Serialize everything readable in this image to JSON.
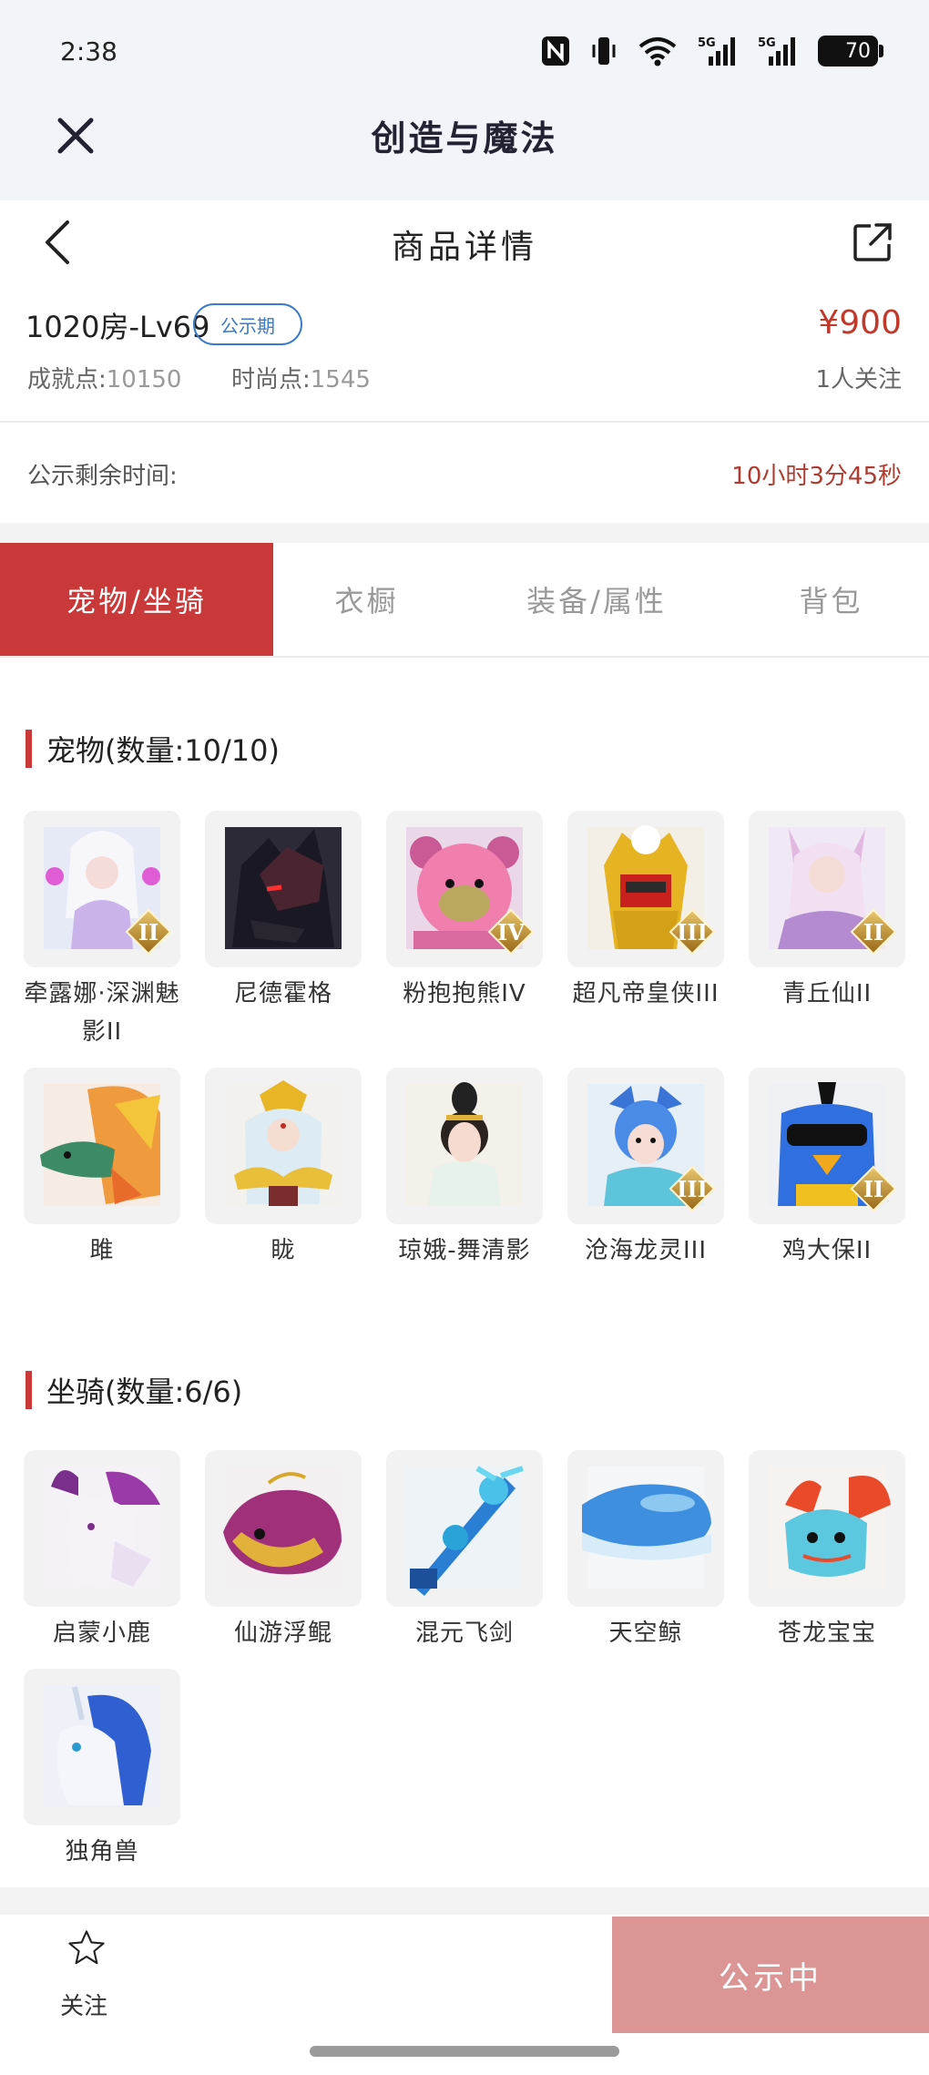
{
  "status_bar": {
    "time": "2:38",
    "battery": "70"
  },
  "app_header": {
    "title": "创造与魔法"
  },
  "nav": {
    "title": "商品详情"
  },
  "listing": {
    "name": "1020房-Lv69",
    "badge": "公示期",
    "price": "¥900",
    "achievement_label": "成就点:",
    "achievement_value": "10150",
    "fashion_label": "时尚点:",
    "fashion_value": "1545",
    "followers": "1人关注"
  },
  "timer": {
    "label": "公示剩余时间:",
    "value": "10小时3分45秒"
  },
  "tabs": [
    {
      "label": "宠物/坐骑",
      "active": true
    },
    {
      "label": "衣橱",
      "active": false
    },
    {
      "label": "装备/属性",
      "active": false
    },
    {
      "label": "背包",
      "active": false
    }
  ],
  "pets_section": {
    "title": "宠物(数量:10/10)",
    "items": [
      {
        "name": "牵露娜·深渊魅影II",
        "badge": "II"
      },
      {
        "name": "尼德霍格",
        "badge": ""
      },
      {
        "name": "粉抱抱熊IV",
        "badge": "IV"
      },
      {
        "name": "超凡帝皇侠III",
        "badge": "III"
      },
      {
        "name": "青丘仙II",
        "badge": "II"
      },
      {
        "name": "雎",
        "badge": ""
      },
      {
        "name": "眬",
        "badge": ""
      },
      {
        "name": "琼娥-舞清影",
        "badge": ""
      },
      {
        "name": "沧海龙灵III",
        "badge": "III"
      },
      {
        "name": "鸡大保II",
        "badge": "II"
      }
    ]
  },
  "mounts_section": {
    "title": "坐骑(数量:6/6)",
    "items": [
      {
        "name": "启蒙小鹿"
      },
      {
        "name": "仙游浮鲲"
      },
      {
        "name": "混元飞剑"
      },
      {
        "name": "天空鲸"
      },
      {
        "name": "苍龙宝宝"
      },
      {
        "name": "独角兽"
      }
    ]
  },
  "bottom_bar": {
    "follow_label": "关注",
    "cta_label": "公示中"
  },
  "colors": {
    "accent": "#c9393a",
    "price": "#c0392b",
    "badge_blue": "#3a7bc8",
    "cta_bg": "#dc9595"
  }
}
